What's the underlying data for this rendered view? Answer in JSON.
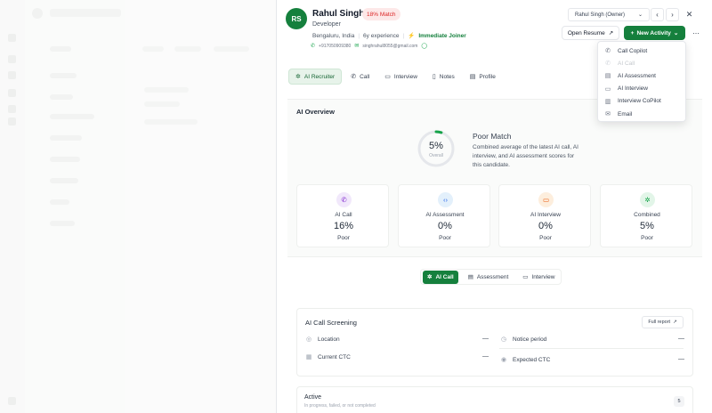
{
  "candidate": {
    "initials": "RS",
    "name": "Rahul Singh",
    "match": "18% Match",
    "role": "Developer",
    "location": "Bengaluru, India",
    "experience": "6y experience",
    "availability": "Immediate Joiner",
    "phone": "+917050909380",
    "email": "singhrahul8055@gmail.com"
  },
  "header": {
    "owner": "Rahul Singh (Owner)",
    "open_resume": "Open Resume",
    "new_activity": "New Activity"
  },
  "activity_menu": [
    {
      "label": "Call Copilot",
      "icon": "phone-icon",
      "glyph": "✆",
      "disabled": false
    },
    {
      "label": "AI Call",
      "icon": "phone-icon",
      "glyph": "✆",
      "disabled": true
    },
    {
      "label": "AI Assessment",
      "icon": "clipboard-icon",
      "glyph": "▤",
      "disabled": false
    },
    {
      "label": "AI Interview",
      "icon": "video-icon",
      "glyph": "▭",
      "disabled": false
    },
    {
      "label": "Interview CoPilot",
      "icon": "document-icon",
      "glyph": "▥",
      "disabled": false
    },
    {
      "label": "Email",
      "icon": "mail-icon",
      "glyph": "✉",
      "disabled": false
    }
  ],
  "tabs": [
    {
      "label": "AI Recruiter",
      "icon": "sparkle-icon",
      "glyph": "✲",
      "active": true
    },
    {
      "label": "Call",
      "icon": "phone-icon",
      "glyph": "✆",
      "active": false
    },
    {
      "label": "Interview",
      "icon": "video-icon",
      "glyph": "▭",
      "active": false
    },
    {
      "label": "Notes",
      "icon": "document-icon",
      "glyph": "▯",
      "active": false
    },
    {
      "label": "Profile",
      "icon": "profile-icon",
      "glyph": "▤",
      "active": false
    }
  ],
  "overview": {
    "title": "AI Overview",
    "overall_pct": "5%",
    "overall_label": "Overall",
    "overall_fraction": 0.05,
    "verdict": "Poor Match",
    "description": "Combined average of the latest AI call, AI interview, and AI assessment scores for this candidate.",
    "cards": [
      {
        "label": "AI Call",
        "value": "16%",
        "status": "Poor",
        "icon": "phone-icon",
        "glyph": "✆",
        "bg": "#f1e8fb",
        "fg": "#7e22ce"
      },
      {
        "label": "AI Assessment",
        "value": "0%",
        "status": "Poor",
        "icon": "code-icon",
        "glyph": "‹›",
        "bg": "#e3f0fb",
        "fg": "#2563eb"
      },
      {
        "label": "AI Interview",
        "value": "0%",
        "status": "Poor",
        "icon": "video-icon",
        "glyph": "▭",
        "bg": "#fdeedd",
        "fg": "#ea580c"
      },
      {
        "label": "Combined",
        "value": "5%",
        "status": "Poor",
        "icon": "sparkle-icon",
        "glyph": "✲",
        "bg": "#e2f5e8",
        "fg": "#16a34a"
      }
    ]
  },
  "sub_tabs": [
    {
      "label": "AI Call",
      "icon": "sparkle-icon",
      "glyph": "✲",
      "active": true
    },
    {
      "label": "Assessment",
      "icon": "clipboard-icon",
      "glyph": "▤",
      "active": false
    },
    {
      "label": "Interview",
      "icon": "video-icon",
      "glyph": "▭",
      "active": false
    }
  ],
  "screening": {
    "title": "AI Call Screening",
    "full_report": "Full report",
    "fields": [
      {
        "label": "Location",
        "value": "—",
        "icon": "location-icon",
        "glyph": "◎"
      },
      {
        "label": "Notice period",
        "value": "—",
        "icon": "clock-icon",
        "glyph": "◷"
      },
      {
        "label": "Current CTC",
        "value": "—",
        "icon": "building-icon",
        "glyph": "▦"
      },
      {
        "label": "Expected CTC",
        "value": "—",
        "icon": "target-icon",
        "glyph": "◉"
      }
    ]
  },
  "active": {
    "title": "Active",
    "subtitle": "In progress, failed, or not completed",
    "count": "5"
  }
}
